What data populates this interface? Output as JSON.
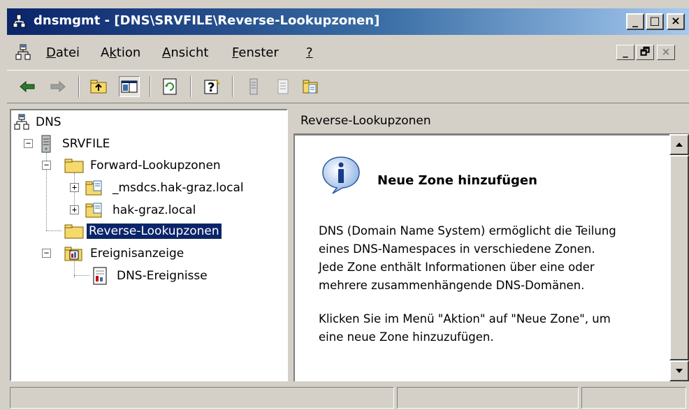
{
  "window": {
    "title": "dnsmgmt - [DNS\\SRVFILE\\Reverse-Lookupzonen]",
    "title_icon": "dns-server-icon",
    "controls": {
      "minimize": "_",
      "maximize": "□",
      "close": "×"
    }
  },
  "menubar": {
    "icon": "mmc-console-icon",
    "items": [
      {
        "label": "Datei",
        "underline": "D"
      },
      {
        "label": "Aktion",
        "underline": "k"
      },
      {
        "label": "Ansicht",
        "underline": "A"
      },
      {
        "label": "Fenster",
        "underline": "F"
      },
      {
        "label": "?",
        "underline": "?"
      }
    ],
    "child_controls": {
      "minimize": "_",
      "restore": "🗗",
      "close": "×"
    }
  },
  "toolbar": {
    "buttons": [
      {
        "name": "back-button",
        "icon": "arrow-left-icon"
      },
      {
        "name": "forward-button",
        "icon": "arrow-right-icon"
      },
      {
        "name": "up-level-button",
        "icon": "folder-up-icon"
      },
      {
        "name": "show-hide-tree-button",
        "icon": "console-tree-icon",
        "pressed": true
      },
      {
        "name": "refresh-button",
        "icon": "refresh-icon"
      },
      {
        "name": "help-button",
        "icon": "help-icon"
      },
      {
        "name": "server-button",
        "icon": "server-icon"
      },
      {
        "name": "properties-button",
        "icon": "properties-icon"
      },
      {
        "name": "new-zone-button",
        "icon": "new-zone-icon"
      }
    ]
  },
  "tree": {
    "root": "DNS",
    "server": "SRVFILE",
    "forward_zones": "Forward-Lookupzonen",
    "zones": [
      "_msdcs.hak-graz.local",
      "hak-graz.local"
    ],
    "reverse_zones": "Reverse-Lookupzonen",
    "event_viewer": "Ereignisanzeige",
    "dns_events": "DNS-Ereignisse",
    "selected": "Reverse-Lookupzonen"
  },
  "details": {
    "header": "Reverse-Lookupzonen",
    "info_icon": "info-icon",
    "title": "Neue Zone hinzufügen",
    "paragraph1": [
      "DNS (Domain Name System) ermöglicht die Teilung",
      "eines DNS-Namespaces in verschiedene Zonen.",
      "Jede Zone enthält Informationen über eine oder",
      "mehrere zusammenhängende DNS-Domänen."
    ],
    "paragraph2": [
      "Klicken Sie im Menü \"Aktion\" auf \"Neue Zone\", um",
      "eine neue Zone hinzuzufügen."
    ]
  },
  "statusbar": {
    "panels": [
      "",
      "",
      ""
    ]
  },
  "colors": {
    "title_start": "#0a246a",
    "title_end": "#a6caf0",
    "face": "#d4d0c8",
    "selection": "#0a246a",
    "folder": "#f5d96b"
  }
}
